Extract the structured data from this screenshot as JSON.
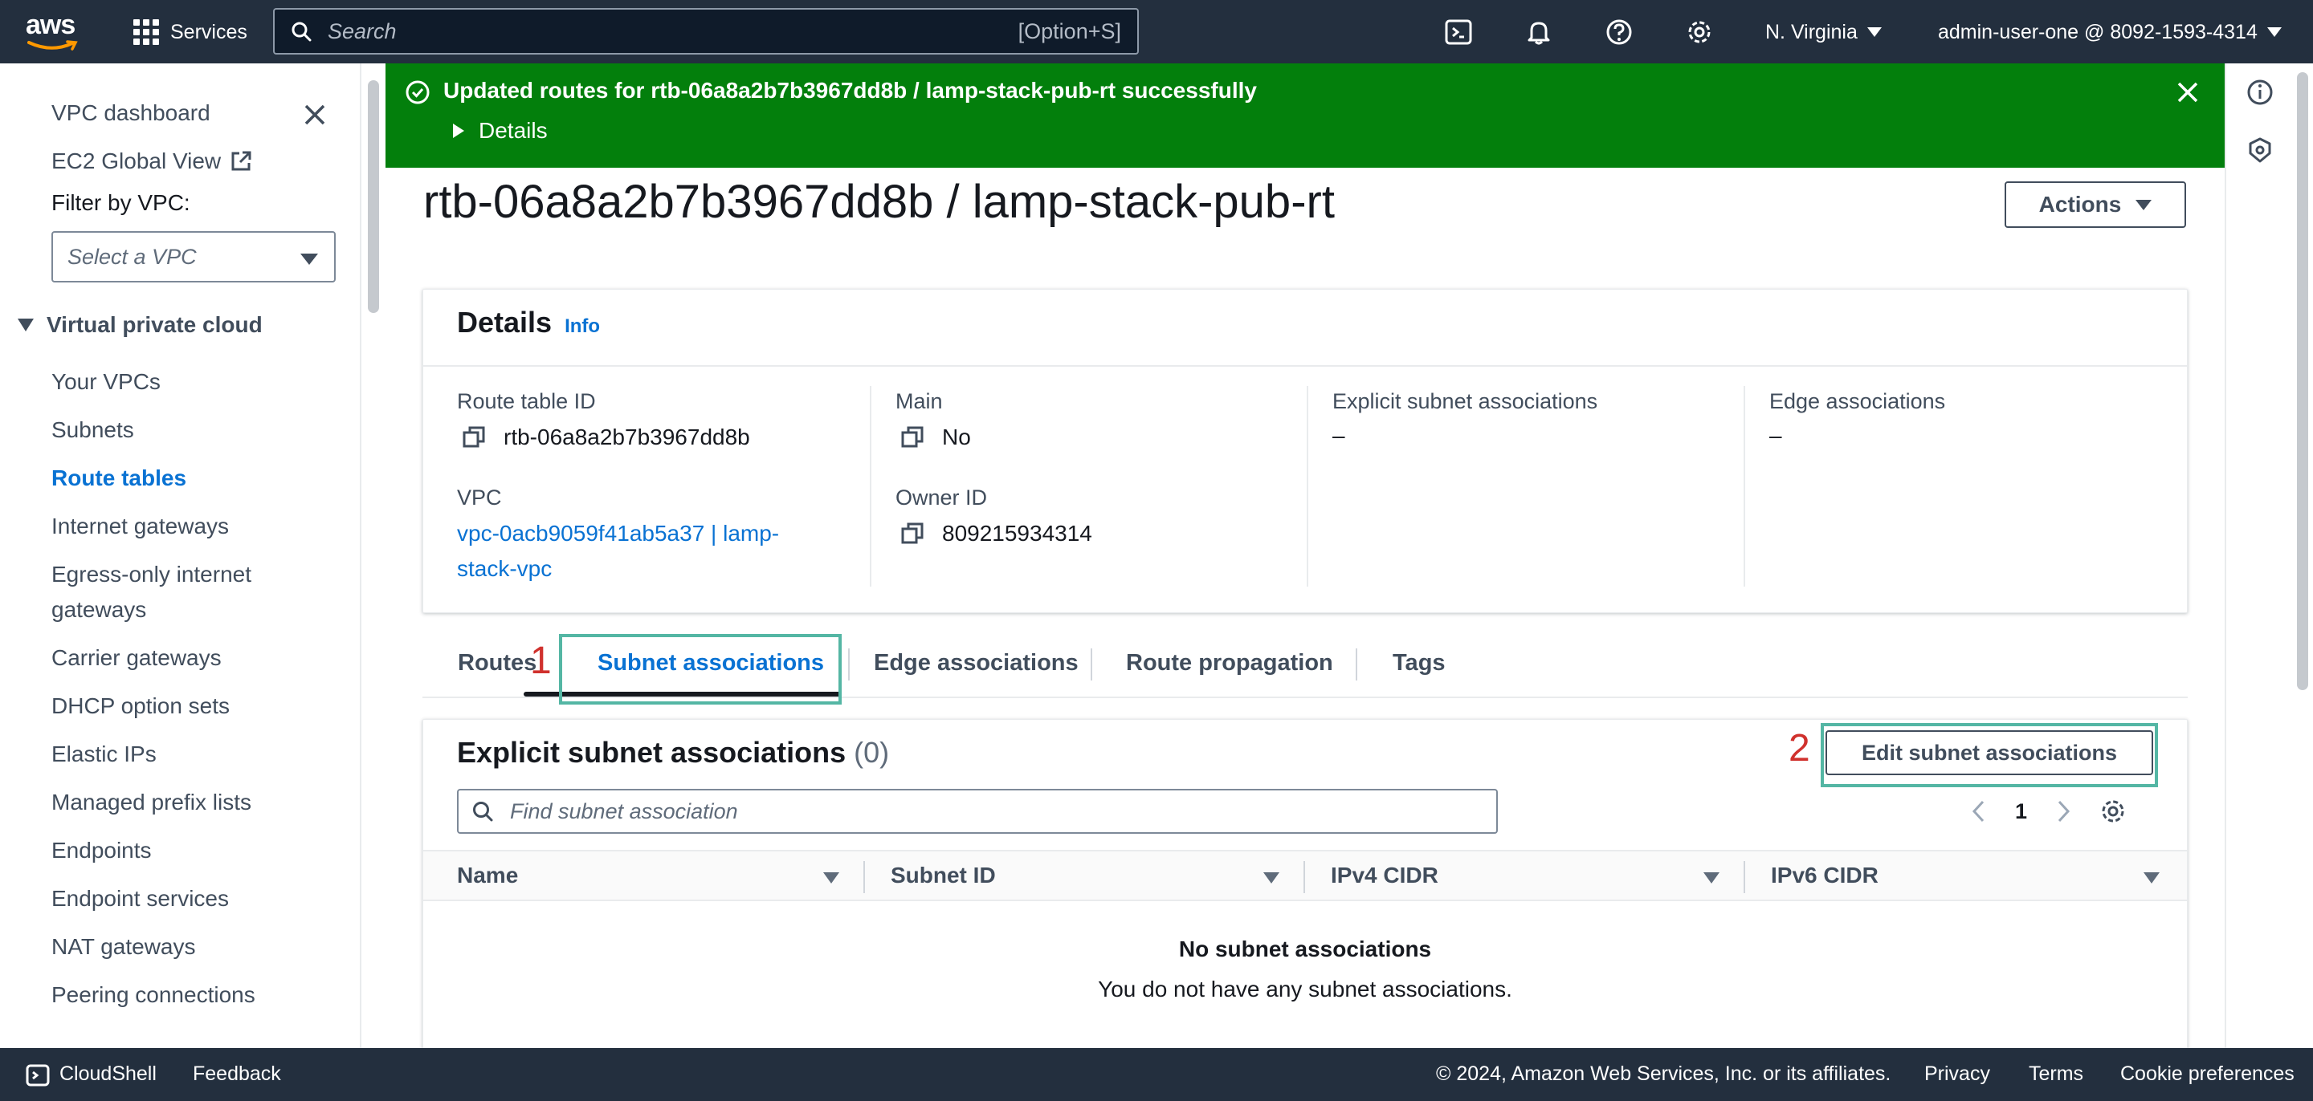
{
  "nav": {
    "services_label": "Services",
    "search_placeholder": "Search",
    "search_shortcut": "[Option+S]",
    "region": "N. Virginia",
    "account": "admin-user-one @ 8092-1593-4314"
  },
  "sidebar": {
    "vpc_dashboard": "VPC dashboard",
    "ec2_global_view": "EC2 Global View",
    "filter_label": "Filter by VPC:",
    "vpc_select_placeholder": "Select a VPC",
    "section_title": "Virtual private cloud",
    "items": [
      {
        "label": "Your VPCs"
      },
      {
        "label": "Subnets"
      },
      {
        "label": "Route tables",
        "active": true
      },
      {
        "label": "Internet gateways"
      },
      {
        "label": "Egress-only internet gateways"
      },
      {
        "label": "Carrier gateways"
      },
      {
        "label": "DHCP option sets"
      },
      {
        "label": "Elastic IPs"
      },
      {
        "label": "Managed prefix lists"
      },
      {
        "label": "Endpoints"
      },
      {
        "label": "Endpoint services"
      },
      {
        "label": "NAT gateways"
      },
      {
        "label": "Peering connections"
      }
    ],
    "egress_line1": "Egress-only internet",
    "egress_line2": "gateways"
  },
  "flash": {
    "message": "Updated routes for rtb-06a8a2b7b3967dd8b / lamp-stack-pub-rt successfully",
    "details_label": "Details",
    "color": "#037f0c"
  },
  "page": {
    "title": "rtb-06a8a2b7b3967dd8b / lamp-stack-pub-rt",
    "actions_label": "Actions"
  },
  "details": {
    "heading": "Details",
    "info_label": "Info",
    "route_table_id_label": "Route table ID",
    "route_table_id": "rtb-06a8a2b7b3967dd8b",
    "main_label": "Main",
    "main_value": "No",
    "explicit_label": "Explicit subnet associations",
    "explicit_value": "–",
    "edge_label": "Edge associations",
    "edge_value": "–",
    "vpc_label": "VPC",
    "vpc_line1": "vpc-0acb9059f41ab5a37 | lamp-",
    "vpc_line2": "stack-vpc",
    "owner_label": "Owner ID",
    "owner_value": "809215934314"
  },
  "tabs": {
    "routes": "Routes",
    "subnet_associations": "Subnet associations",
    "edge_associations": "Edge associations",
    "route_propagation": "Route propagation",
    "tags": "Tags",
    "active": "Subnet associations"
  },
  "annotations": {
    "marker1": "1",
    "marker2": "2",
    "highlight_color": "#54b6a4",
    "marker_color": "#d0312d"
  },
  "assoc": {
    "title": "Explicit subnet associations",
    "count": "(0)",
    "edit_button": "Edit subnet associations",
    "filter_placeholder": "Find subnet association",
    "page_number": "1",
    "columns": [
      "Name",
      "Subnet ID",
      "IPv4 CIDR",
      "IPv6 CIDR"
    ],
    "empty_title": "No subnet associations",
    "empty_subtitle": "You do not have any subnet associations."
  },
  "footer": {
    "cloudshell": "CloudShell",
    "feedback": "Feedback",
    "copyright": "© 2024, Amazon Web Services, Inc. or its affiliates.",
    "privacy": "Privacy",
    "terms": "Terms",
    "cookie": "Cookie preferences"
  },
  "icons": {
    "grid": "grid-icon",
    "search": "search-icon",
    "cloudshell": "cloudshell-icon",
    "notifications": "bell-icon",
    "help": "help-icon",
    "settings": "gear-icon",
    "copy": "copy-icon",
    "success": "check-circle-icon",
    "close": "close-icon",
    "external": "external-link-icon",
    "info": "info-icon",
    "security": "shield-icon"
  }
}
